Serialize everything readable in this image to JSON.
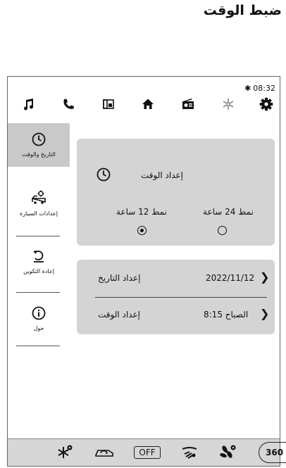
{
  "page_title": "ضبط الوقت",
  "status": {
    "bluetooth": "✱",
    "time": "08:32"
  },
  "topbar": {
    "icons": [
      "music-icon",
      "phone-icon",
      "apps-icon",
      "home-icon",
      "radio-icon",
      "climate-icon",
      "settings-icon"
    ]
  },
  "sidebar": {
    "items": [
      {
        "label": "التاريخ والوقت",
        "icon": "clock-icon",
        "active": true
      },
      {
        "label": "إعدادات السيارة",
        "icon": "car-settings-icon",
        "active": false
      },
      {
        "label": "إعادة التكوين",
        "icon": "reset-icon",
        "active": false
      },
      {
        "label": "حول",
        "icon": "info-icon",
        "active": false
      }
    ]
  },
  "time_panel": {
    "title": "إعداد الوقت",
    "option_24": "نمط 24 ساعة",
    "option_12": "نمط 12 ساعة",
    "selected": "12"
  },
  "settings_panel": {
    "date_label": "إعداد التاريخ",
    "date_value": "2022/11/12",
    "time_label": "إعداد الوقت",
    "time_value": "الصباح 8:15"
  },
  "bottombar": {
    "off_label": "OFF",
    "view_360_label": "360",
    "icons": [
      "rear-defrost-icon",
      "recirculation-icon",
      "off-button",
      "windshield-airflow-icon",
      "fan-icon",
      "360-view-button"
    ]
  },
  "colors": {
    "active_bg": "#c9c9c9",
    "panel_bg": "#d4d4d4",
    "bar_bg": "#d6d6d6"
  }
}
